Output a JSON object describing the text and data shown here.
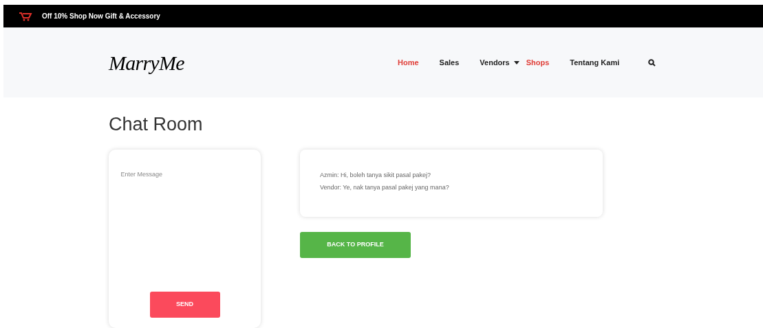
{
  "promo_bar": {
    "text": "Off 10% Shop Now Gift & Accessory"
  },
  "logo": {
    "text": "MarryMe"
  },
  "nav": [
    {
      "label": "Home",
      "selected": true,
      "dropdown": false
    },
    {
      "label": "Sales",
      "selected": false,
      "dropdown": false
    },
    {
      "label": "Vendors",
      "selected": false,
      "dropdown": true
    },
    {
      "label": "Shops",
      "selected": true,
      "dropdown": false
    },
    {
      "label": "Tentang Kami",
      "selected": false,
      "dropdown": false
    }
  ],
  "page_title": "Chat Room",
  "message_form": {
    "placeholder": "Enter Message",
    "send_button": "SEND"
  },
  "messages": [
    "Azmin: Hi, boleh tanya sikit pasal pakej?",
    "Vendor: Ye, nak tanya pasal pakej yang mana?"
  ],
  "back_button": "BACK TO PROFILE"
}
